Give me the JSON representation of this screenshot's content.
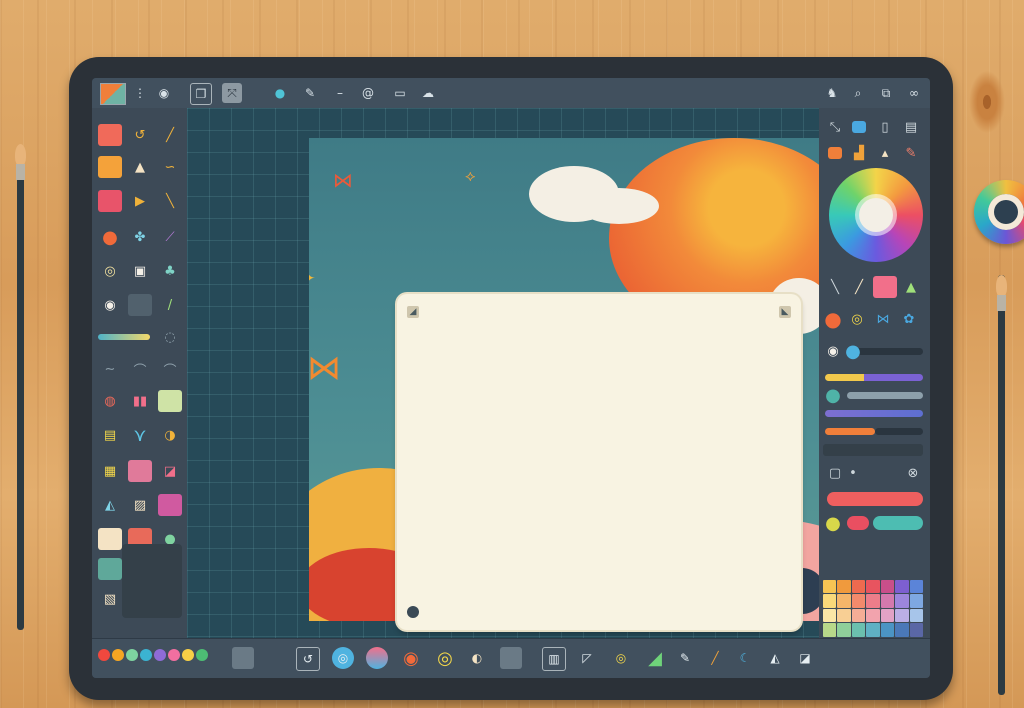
{
  "scene": {
    "description_free": true,
    "accent_colors": {
      "sun": "#f28a3a",
      "teal_canvas": "#264a58",
      "frame_paper": "#f8f3e2",
      "panel": "#3d4a57",
      "wood": "#dca260"
    }
  },
  "toolbar": {
    "items": [
      {
        "name": "color-swatch-icon"
      },
      {
        "name": "more-vertical-icon"
      },
      {
        "name": "record-icon"
      },
      {
        "name": "document-icon"
      },
      {
        "name": "transform-icon"
      },
      {
        "name": "drop-icon"
      },
      {
        "name": "pen-icon"
      },
      {
        "name": "minus-icon"
      },
      {
        "name": "spiral-icon"
      },
      {
        "name": "layers-icon"
      },
      {
        "name": "cloud-icon"
      }
    ],
    "right_items": [
      {
        "name": "animal-icon"
      },
      {
        "name": "search-icon"
      },
      {
        "name": "share-icon"
      },
      {
        "name": "glasses-icon"
      }
    ]
  },
  "left_tools": {
    "rows": 14,
    "icon_names": [
      "brush-icon",
      "hook-icon",
      "line-icon",
      "bucket-icon",
      "triangle-icon",
      "curve-icon",
      "shape-icon",
      "arrow-icon",
      "stroke-icon",
      "circle-icon",
      "flower-icon",
      "pencil-icon"
    ]
  },
  "right_panel": {
    "color_wheel": "hsv",
    "sliders": [
      {
        "color": "#f2c94c"
      },
      {
        "color": "#4fb3a8"
      },
      {
        "color": "#7d6fd1"
      },
      {
        "color": "#f07f3a"
      }
    ],
    "buttons": [
      {
        "color": "#ef5f5f"
      },
      {
        "color": "#e94f61"
      },
      {
        "color": "#4dbdb2"
      }
    ]
  },
  "swatch_grid_colors": [
    "#f6c453",
    "#f09a3d",
    "#ee6a4f",
    "#e8545f",
    "#c94f8a",
    "#7d5fd0",
    "#5b84d8",
    "#f9d97a",
    "#f5b66a",
    "#f28a6c",
    "#ec7d8a",
    "#d479ad",
    "#9c86dc",
    "#7ea8e2",
    "#fbe7a6",
    "#f8cf94",
    "#f5ad96",
    "#f2a3ad",
    "#e2a2c6",
    "#bbaee6",
    "#a7c5ea",
    "#b8d98a",
    "#8fcf9a",
    "#6bbfae",
    "#5fb0c4",
    "#4b94c4",
    "#4a78b8",
    "#5a67a6",
    "#cfe5ab",
    "#afdcb8",
    "#93d0c6",
    "#8ac6d6",
    "#7fb2d6",
    "#7e9fcf",
    "#8490c2",
    "#8c9aa4",
    "#7d8c96",
    "#6b7b86",
    "#5d6c77",
    "#4f5e69",
    "#43525c",
    "#37454f",
    "#b4bcc2",
    "#a2abb2",
    "#8f9aa2",
    "#7c8892",
    "#6a7782",
    "#586672",
    "#4a5762",
    "#dde1e4",
    "#cdd2d6",
    "#bcc2c7",
    "#aab1b7",
    "#989fa6",
    "#868e95",
    "#747c84"
  ],
  "bottom_bar": {
    "palette_dots": [
      "#f0483e",
      "#f5a623",
      "#7ed3a0",
      "#3bb3d1",
      "#8e6bd7",
      "#f26fa0",
      "#f7d046",
      "#4dbd74"
    ],
    "tool_icons": [
      "eraser-icon",
      "hook-icon",
      "circle-icon",
      "stack-icon",
      "ring-icon",
      "donut-icon",
      "camera-icon",
      "square-icon",
      "clipboard-icon",
      "chat-icon",
      "pin-icon",
      "leaf-icon",
      "brush-icon",
      "crescent-icon",
      "shape-icon"
    ]
  }
}
